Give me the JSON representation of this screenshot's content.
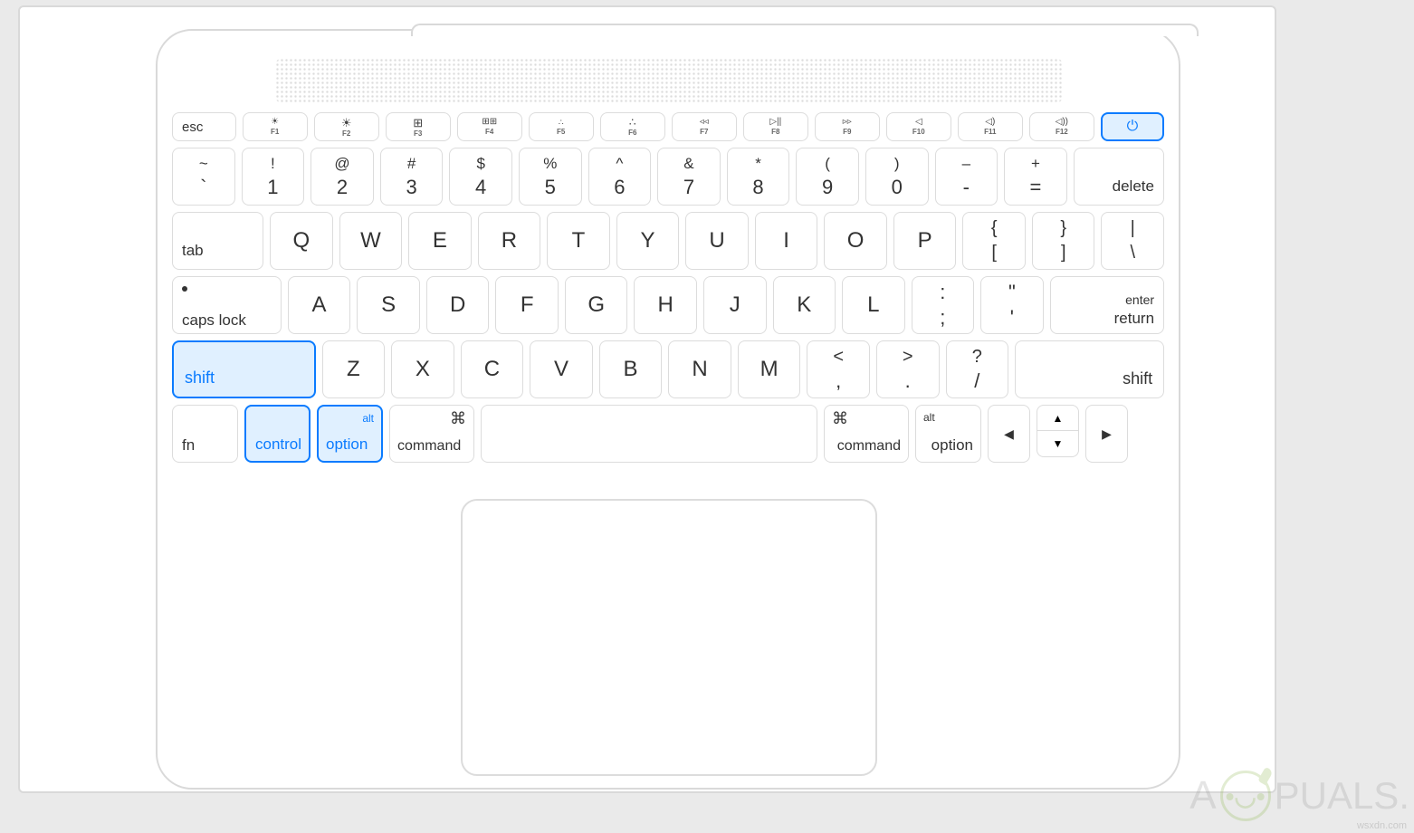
{
  "highlighted_keys": [
    "shift-left",
    "control",
    "option-left",
    "power"
  ],
  "function_row": {
    "esc": "esc",
    "keys": [
      {
        "icon": "☀︎",
        "sub": "F1",
        "small": true
      },
      {
        "icon": "☀",
        "sub": "F2"
      },
      {
        "icon": "⊞",
        "sub": "F3"
      },
      {
        "icon": "⊞⊞",
        "sub": "F4"
      },
      {
        "icon": "∴",
        "sub": "F5",
        "small": true
      },
      {
        "icon": "∴",
        "sub": "F6"
      },
      {
        "icon": "◃◃",
        "sub": "F7"
      },
      {
        "icon": "▷||",
        "sub": "F8"
      },
      {
        "icon": "▹▹",
        "sub": "F9"
      },
      {
        "icon": "◁",
        "sub": "F10"
      },
      {
        "icon": "◁)",
        "sub": "F11"
      },
      {
        "icon": "◁))",
        "sub": "F12"
      }
    ],
    "power": "⏻"
  },
  "number_row": {
    "keys": [
      {
        "top": "~",
        "bot": "`"
      },
      {
        "top": "!",
        "bot": "1"
      },
      {
        "top": "@",
        "bot": "2"
      },
      {
        "top": "#",
        "bot": "3"
      },
      {
        "top": "$",
        "bot": "4"
      },
      {
        "top": "%",
        "bot": "5"
      },
      {
        "top": "^",
        "bot": "6"
      },
      {
        "top": "&",
        "bot": "7"
      },
      {
        "top": "*",
        "bot": "8"
      },
      {
        "top": "(",
        "bot": "9"
      },
      {
        "top": ")",
        "bot": "0"
      },
      {
        "top": "–",
        "bot": "-"
      },
      {
        "top": "+",
        "bot": "="
      }
    ],
    "delete": "delete"
  },
  "q_row": {
    "tab": "tab",
    "letters": [
      "Q",
      "W",
      "E",
      "R",
      "T",
      "Y",
      "U",
      "I",
      "O",
      "P"
    ],
    "brackets": [
      {
        "top": "{",
        "bot": "["
      },
      {
        "top": "}",
        "bot": "]"
      },
      {
        "top": "|",
        "bot": "\\"
      }
    ]
  },
  "a_row": {
    "caps": "caps lock",
    "letters": [
      "A",
      "S",
      "D",
      "F",
      "G",
      "H",
      "J",
      "K",
      "L"
    ],
    "punct": [
      {
        "top": ":",
        "bot": ";"
      },
      {
        "top": "\"",
        "bot": "'"
      }
    ],
    "enter": "enter",
    "return": "return"
  },
  "z_row": {
    "shift": "shift",
    "letters": [
      "Z",
      "X",
      "C",
      "V",
      "B",
      "N",
      "M"
    ],
    "punct": [
      {
        "top": "<",
        "bot": ","
      },
      {
        "top": ">",
        "bot": "."
      },
      {
        "top": "?",
        "bot": "/"
      }
    ]
  },
  "bottom_row": {
    "fn": "fn",
    "control": "control",
    "alt": "alt",
    "option": "option",
    "command": "command",
    "cmd_sym": "⌘"
  },
  "arrows": {
    "left": "◀",
    "up": "▲",
    "down": "▼",
    "right": "▶"
  },
  "watermark": {
    "brand": "PUALS.",
    "url": "wsxdn.com"
  }
}
